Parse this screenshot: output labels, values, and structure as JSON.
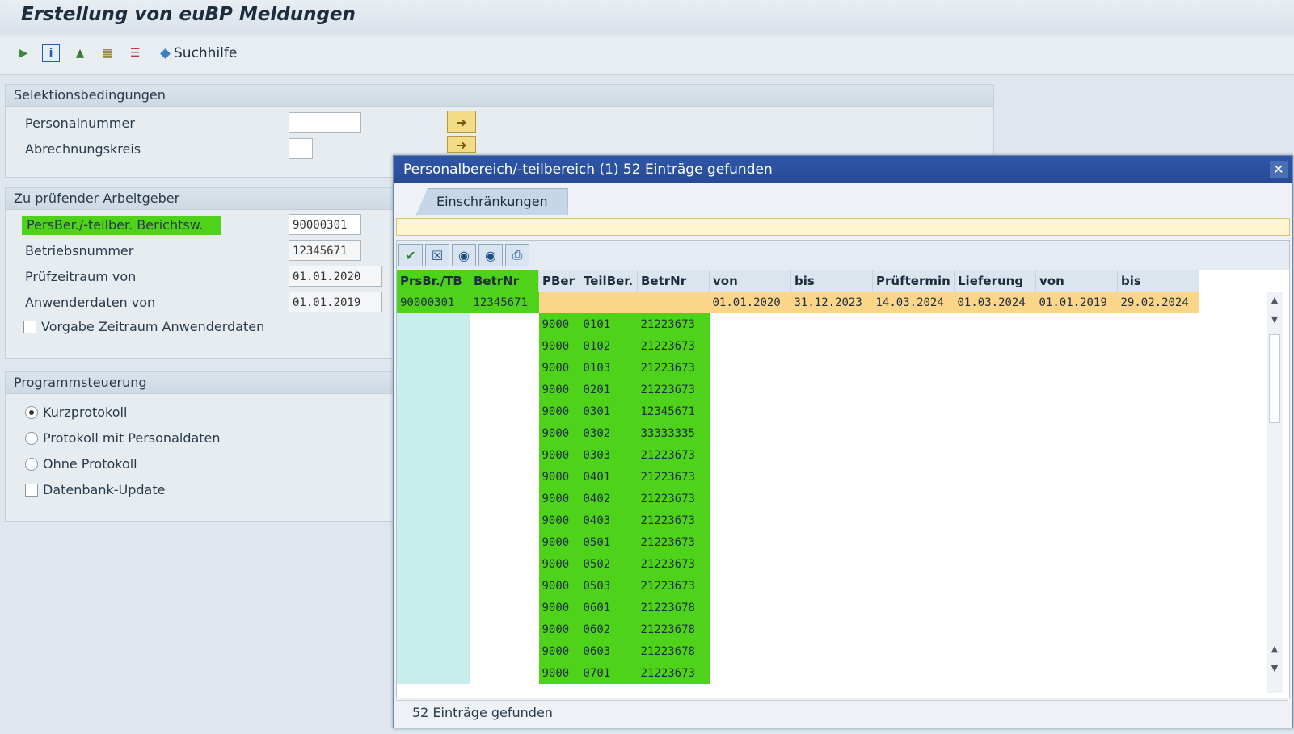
{
  "window": {
    "title": "Erstellung von euBP Meldungen"
  },
  "toolbar": {
    "suchhilfe_label": "Suchhilfe"
  },
  "selektion": {
    "header": "Selektionsbedingungen",
    "personalnummer_label": "Personalnummer",
    "personalnummer_value": "",
    "abrechnungskreis_label": "Abrechnungskreis",
    "abrechnungskreis_value": ""
  },
  "arbeitgeber": {
    "header": "Zu prüfender Arbeitgeber",
    "persber_label": "PersBer./-teilber. Berichtsw.",
    "persber_value": "90000301",
    "betriebsnummer_label": "Betriebsnummer",
    "betriebsnummer_value": "12345671",
    "pruefzeitraum_label": "Prüfzeitraum von",
    "pruefzeitraum_value": "01.01.2020",
    "anwenderdaten_label": "Anwenderdaten von",
    "anwenderdaten_value": "01.01.2019",
    "vorgabe_label": "Vorgabe Zeitraum Anwenderdaten"
  },
  "programm": {
    "header": "Programmsteuerung",
    "kurz_label": "Kurzprotokoll",
    "mit_label": "Protokoll mit Personaldaten",
    "ohne_label": "Ohne Protokoll",
    "db_label": "Datenbank-Update",
    "selected": "Kurzprotokoll"
  },
  "popup": {
    "title": "Personalbereich/-teilbereich (1)   52 Einträge gefunden",
    "tab_label": "Einschränkungen",
    "status": "52 Einträge gefunden",
    "columns": [
      "PrsBr./TB",
      "BetrNr",
      "PBer",
      "TeilBer.",
      "BetrNr",
      "von",
      "bis",
      "Prüftermin",
      "Lieferung",
      "von",
      "bis"
    ],
    "main_row": [
      "90000301",
      "12345671",
      "",
      "",
      "",
      "01.01.2020",
      "31.12.2023",
      "14.03.2024",
      "01.03.2024",
      "01.01.2019",
      "29.02.2024"
    ],
    "rows": [
      [
        "9000",
        "0101",
        "21223673"
      ],
      [
        "9000",
        "0102",
        "21223673"
      ],
      [
        "9000",
        "0103",
        "21223673"
      ],
      [
        "9000",
        "0201",
        "21223673"
      ],
      [
        "9000",
        "0301",
        "12345671"
      ],
      [
        "9000",
        "0302",
        "33333335"
      ],
      [
        "9000",
        "0303",
        "21223673"
      ],
      [
        "9000",
        "0401",
        "21223673"
      ],
      [
        "9000",
        "0402",
        "21223673"
      ],
      [
        "9000",
        "0403",
        "21223673"
      ],
      [
        "9000",
        "0501",
        "21223673"
      ],
      [
        "9000",
        "0502",
        "21223673"
      ],
      [
        "9000",
        "0503",
        "21223673"
      ],
      [
        "9000",
        "0601",
        "21223678"
      ],
      [
        "9000",
        "0602",
        "21223678"
      ],
      [
        "9000",
        "0603",
        "21223678"
      ],
      [
        "9000",
        "0701",
        "21223673"
      ]
    ]
  },
  "colors": {
    "highlight": "#4fd21a",
    "selected_row": "#fbd588",
    "title_bar": "#2f57a8"
  }
}
